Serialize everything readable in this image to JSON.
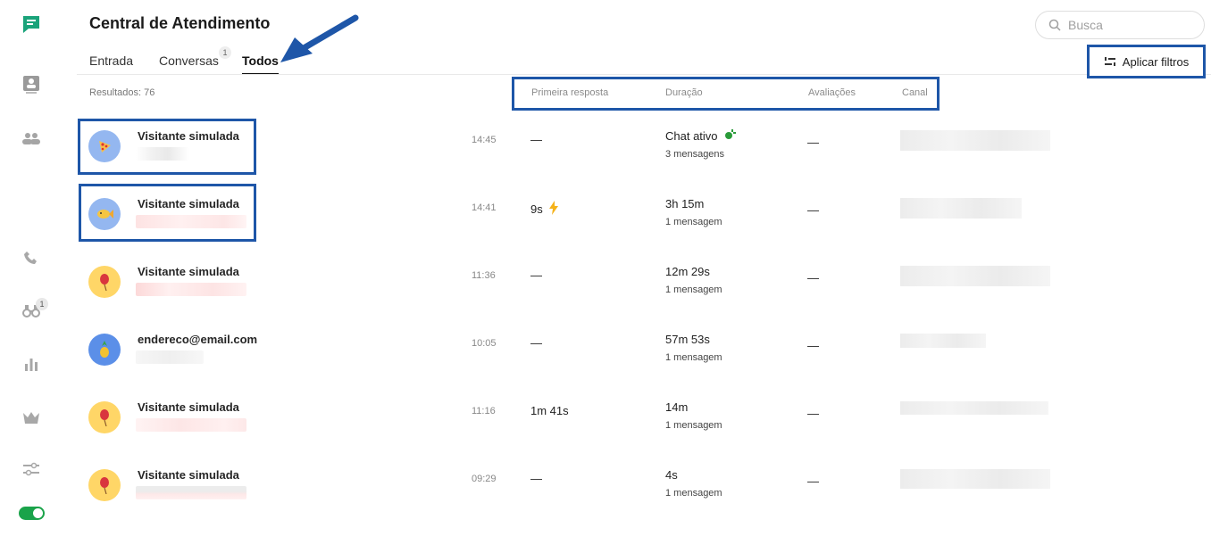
{
  "app": {
    "title": "Central de Atendimento",
    "rail_badge": "1"
  },
  "tabs": [
    {
      "label": "Entrada"
    },
    {
      "label": "Conversas",
      "badge": "1"
    },
    {
      "label": "Todos",
      "active": true
    }
  ],
  "search": {
    "placeholder": "Busca"
  },
  "filter": {
    "label": "Aplicar filtros"
  },
  "results": {
    "label": "Resultados: 76"
  },
  "columns": {
    "first_response": "Primeira resposta",
    "duration": "Duração",
    "ratings": "Avaliações",
    "channel": "Canal"
  },
  "rows": [
    {
      "name": "Visitante simulada",
      "time": "14:45",
      "first_response": "—",
      "duration": "Chat ativo",
      "messages": "3 mensagens",
      "rating": "—",
      "avatar": "pizza",
      "highlighted": true
    },
    {
      "name": "Visitante simulada",
      "time": "14:41",
      "first_response": "9s",
      "duration": "3h 15m",
      "messages": "1 mensagem",
      "rating": "—",
      "avatar": "fish",
      "highlighted": true
    },
    {
      "name": "Visitante simulada",
      "time": "11:36",
      "first_response": "—",
      "duration": "12m 29s",
      "messages": "1 mensagem",
      "rating": "—",
      "avatar": "balloon"
    },
    {
      "name": "endereco@email.com",
      "time": "10:05",
      "first_response": "—",
      "duration": "57m 53s",
      "messages": "1 mensagem",
      "rating": "—",
      "avatar": "pineapple"
    },
    {
      "name": "Visitante simulada",
      "time": "11:16",
      "first_response": "1m 41s",
      "duration": "14m",
      "messages": "1 mensagem",
      "rating": "—",
      "avatar": "balloon"
    },
    {
      "name": "Visitante simulada",
      "time": "09:29",
      "first_response": "—",
      "duration": "4s",
      "messages": "1 mensagem",
      "rating": "—",
      "avatar": "balloon"
    }
  ],
  "colors": {
    "accent_green": "#1aa34a",
    "highlight_blue": "#1e56a8",
    "lightning": "#f5b21a"
  }
}
